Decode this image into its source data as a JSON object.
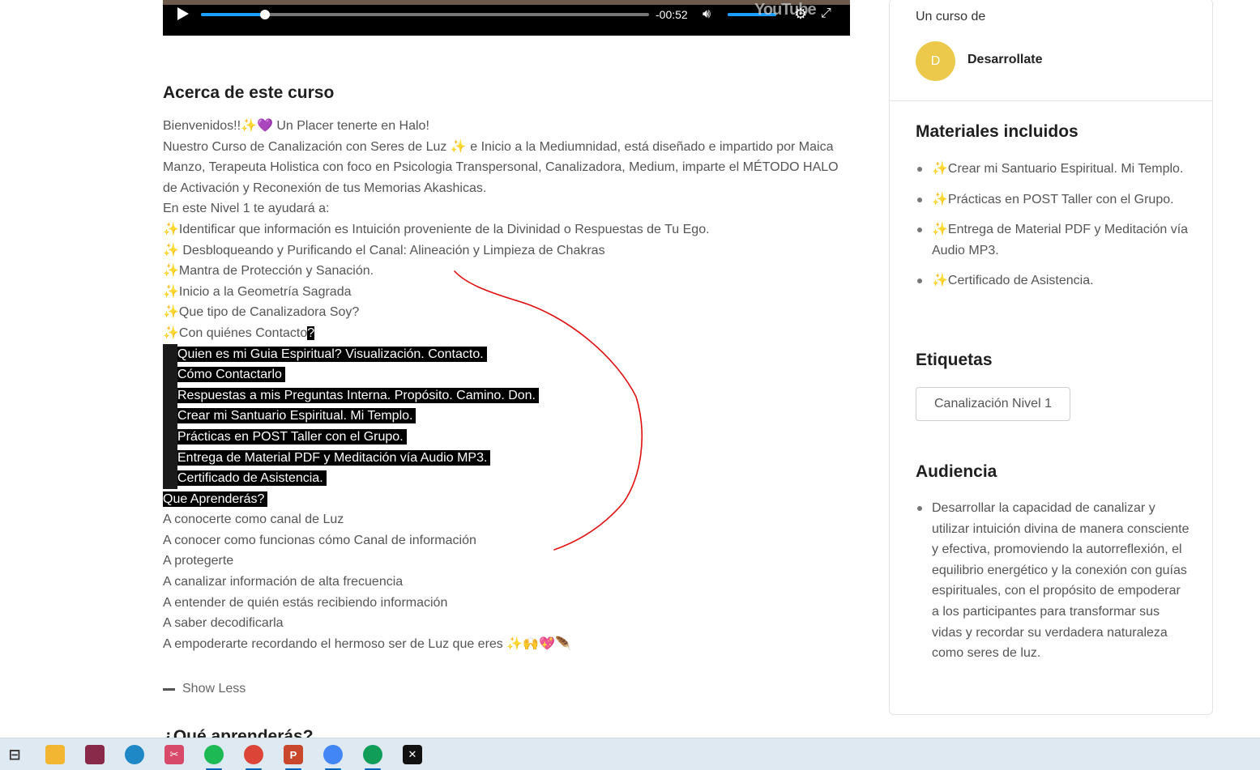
{
  "video": {
    "time_remaining": "-00:52",
    "played_fraction": 0.143,
    "volume_fraction": 1.0,
    "brand": "YouTube",
    "icons": [
      "play-icon",
      "volume-icon",
      "gear-icon",
      "fullscreen-icon"
    ]
  },
  "main": {
    "heading": "Acerca de este curso",
    "lines": {
      "l1": "Bienvenidos!!✨💜 Un Placer tenerte en Halo!",
      "l2": "Nuestro Curso de Canalización con Seres de Luz ✨ e Inicio a la Mediumnidad, está diseñado e impartido por Maica Manzo, Terapeuta Holistica con foco en Psicologia Transpersonal, Canalizadora, Medium, imparte el MÉTODO HALO de Activación y Reconexión de tus Memorias Akashicas.",
      "l3": "En este Nivel 1 te ayudará a:",
      "l4": "✨Identificar que información es Intuición proveniente de la Divinidad o Respuestas de Tu Ego.",
      "l5": "✨ Desbloqueando y Purificando el Canal: Alineación y Limpieza de Chakras",
      "l6": "✨Mantra de Protección y Sanación.",
      "l7": "✨Inicio a la Geometría Sagrada",
      "l8": "✨Que tipo de Canalizadora Soy?",
      "l9a": "✨Con quiénes Contacto",
      "l9b": "?",
      "l10": "Quien es mi Guia Espiritual? Visualización. Contacto.",
      "l11": "Cómo Contactarlo",
      "l12": "Respuestas a mis Preguntas Interna. Propósito. Camino. Don.",
      "l13": "Crear mi Santuario Espiritual. Mi Templo.",
      "l14": "Prácticas en POST Taller con el Grupo.",
      "l15": "Entrega de Material PDF y Meditación vía Audio MP3.",
      "l16": "Certificado de Asistencia.",
      "l17": "Que Aprenderás?",
      "l18": "A conocerte como canal de Luz",
      "l19": "A conocer como funcionas cómo Canal de información",
      "l20": "A protegerte",
      "l21": "A canalizar información de alta frecuencia",
      "l22": "A entender de quién estás recibiendo información",
      "l23": "A saber decodificarla",
      "l24": "A empoderarte recordando el hermoso ser de Luz que eres ✨🙌💖🪶"
    },
    "show_less": "Show Less",
    "next_heading": "¿Qué aprenderás?"
  },
  "sidebar": {
    "by_label": "Un curso de",
    "avatar_letter": "D",
    "avatar_color": "#ecc94b",
    "author": "Desarrollate",
    "materials_title": "Materiales incluidos",
    "materials": [
      "✨Crear mi Santuario Espiritual. Mi Templo.",
      "✨Prácticas en POST Taller con el Grupo.",
      "✨Entrega de Material PDF y Meditación vía Audio MP3.",
      "✨Certificado de Asistencia."
    ],
    "tags_title": "Etiquetas",
    "tag": "Canalización Nivel 1",
    "audience_title": "Audiencia",
    "audience": [
      "Desarrollar la capacidad de canalizar y utilizar intuición divina de manera consciente y efectiva, promoviendo la autorreflexión, el equilibrio energético y la conexión con guías espirituales, con el propósito de empoderar a los participantes para transformar sus vidas y recordar su verdadera naturaleza como seres de luz."
    ]
  },
  "taskbar": {
    "background": "#dfe9f2",
    "icons": [
      {
        "name": "task-view-icon",
        "glyph": "⊟",
        "color": "#333333"
      },
      {
        "name": "file-explorer-icon",
        "glyph": "",
        "color": "#f2b632"
      },
      {
        "name": "winrar-icon",
        "glyph": "",
        "color": "#8a2a4a"
      },
      {
        "name": "edge-icon",
        "glyph": "",
        "color": "#1e88c7"
      },
      {
        "name": "snipping-tool-icon",
        "glyph": "✂",
        "color": "#d84a6a"
      },
      {
        "name": "spotify-icon",
        "glyph": "",
        "color": "#1db954"
      },
      {
        "name": "chrome-icon",
        "glyph": "",
        "color": "#db4437"
      },
      {
        "name": "powerpoint-icon",
        "glyph": "P",
        "color": "#c9472c"
      },
      {
        "name": "chrome-profile-icon",
        "glyph": "",
        "color": "#4285f4"
      },
      {
        "name": "chrome-profile-2-icon",
        "glyph": "",
        "color": "#0f9d58"
      },
      {
        "name": "capcut-icon",
        "glyph": "✕",
        "color": "#111111"
      }
    ]
  }
}
